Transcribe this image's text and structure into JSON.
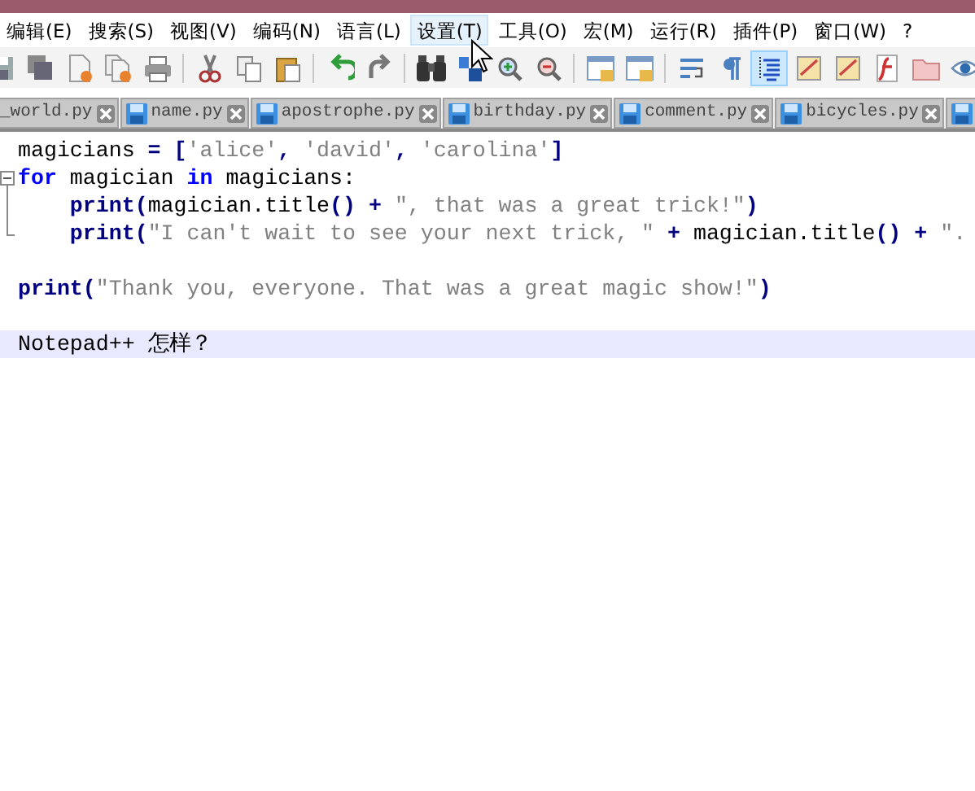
{
  "menu": [
    {
      "label": "编辑(E)",
      "hovered": false
    },
    {
      "label": "搜索(S)",
      "hovered": false
    },
    {
      "label": "视图(V)",
      "hovered": false
    },
    {
      "label": "编码(N)",
      "hovered": false
    },
    {
      "label": "语言(L)",
      "hovered": false
    },
    {
      "label": "设置(T)",
      "hovered": true
    },
    {
      "label": "工具(O)",
      "hovered": false
    },
    {
      "label": "宏(M)",
      "hovered": false
    },
    {
      "label": "运行(R)",
      "hovered": false
    },
    {
      "label": "插件(P)",
      "hovered": false
    },
    {
      "label": "窗口(W)",
      "hovered": false
    },
    {
      "label": "?",
      "hovered": false
    }
  ],
  "toolbar": [
    {
      "kind": "save",
      "pressed": false
    },
    {
      "kind": "save-all",
      "pressed": false
    },
    {
      "kind": "close",
      "pressed": false
    },
    {
      "kind": "close-all",
      "pressed": false
    },
    {
      "kind": "print",
      "pressed": false
    },
    {
      "kind": "sep"
    },
    {
      "kind": "cut",
      "pressed": false
    },
    {
      "kind": "copy",
      "pressed": false
    },
    {
      "kind": "paste",
      "pressed": false
    },
    {
      "kind": "sep"
    },
    {
      "kind": "undo",
      "pressed": false
    },
    {
      "kind": "redo",
      "pressed": false
    },
    {
      "kind": "sep"
    },
    {
      "kind": "find",
      "pressed": false
    },
    {
      "kind": "replace",
      "pressed": false
    },
    {
      "kind": "zoom-in",
      "pressed": false
    },
    {
      "kind": "zoom-out",
      "pressed": false
    },
    {
      "kind": "sep"
    },
    {
      "kind": "sync",
      "pressed": false
    },
    {
      "kind": "sync",
      "pressed": false
    },
    {
      "kind": "sep"
    },
    {
      "kind": "wrap",
      "pressed": false
    },
    {
      "kind": "pilcrow",
      "pressed": false
    },
    {
      "kind": "indent",
      "pressed": true
    },
    {
      "kind": "map",
      "pressed": false
    },
    {
      "kind": "map",
      "pressed": false
    },
    {
      "kind": "function",
      "pressed": false
    },
    {
      "kind": "folder",
      "pressed": false
    },
    {
      "kind": "eye",
      "pressed": false
    }
  ],
  "tabs": [
    {
      "label": "_world.py",
      "selected": false,
      "icon": false
    },
    {
      "label": "name.py",
      "selected": false,
      "icon": true
    },
    {
      "label": "apostrophe.py",
      "selected": false,
      "icon": true
    },
    {
      "label": "birthday.py",
      "selected": false,
      "icon": true
    },
    {
      "label": "comment.py",
      "selected": false,
      "icon": true
    },
    {
      "label": "bicycles.py",
      "selected": false,
      "icon": true
    },
    {
      "selected": false,
      "icon": true
    }
  ],
  "editor": {
    "lines": [
      {
        "current": false,
        "tokens": [
          {
            "kind": "plain",
            "text": "magicians "
          },
          {
            "kind": "op",
            "text": "= ["
          },
          {
            "kind": "string",
            "text": "'alice'"
          },
          {
            "kind": "op",
            "text": ", "
          },
          {
            "kind": "string",
            "text": "'david'"
          },
          {
            "kind": "op",
            "text": ", "
          },
          {
            "kind": "string",
            "text": "'carolina'"
          },
          {
            "kind": "op",
            "text": "]"
          }
        ]
      },
      {
        "current": false,
        "expanded": true,
        "tokens": [
          {
            "kind": "keyword",
            "text": "for"
          },
          {
            "kind": "plain",
            "text": " magician "
          },
          {
            "kind": "keyword",
            "text": "in"
          },
          {
            "kind": "plain",
            "text": " magicians:"
          }
        ],
        "children": [
          {
            "current": false,
            "tokens": [
              {
                "kind": "builtin",
                "text": "    print"
              },
              {
                "kind": "op",
                "text": "("
              },
              {
                "kind": "plain",
                "text": "magician.title"
              },
              {
                "kind": "op",
                "text": "() + "
              },
              {
                "kind": "string",
                "text": "\", that was a great trick!\""
              },
              {
                "kind": "op",
                "text": ")"
              }
            ]
          },
          {
            "current": false,
            "tokens": [
              {
                "kind": "builtin",
                "text": "    print"
              },
              {
                "kind": "op",
                "text": "("
              },
              {
                "kind": "string",
                "text": "\"I can't wait to see your next trick, \""
              },
              {
                "kind": "op",
                "text": " + "
              },
              {
                "kind": "plain",
                "text": "magician.title"
              },
              {
                "kind": "op",
                "text": "() + "
              },
              {
                "kind": "string",
                "text": "\"."
              }
            ]
          }
        ]
      },
      {
        "current": false
      },
      {
        "current": false,
        "tokens": [
          {
            "kind": "builtin",
            "text": "print"
          },
          {
            "kind": "op",
            "text": "("
          },
          {
            "kind": "string",
            "text": "\"Thank you, everyone. That was a great magic show!\""
          },
          {
            "kind": "op",
            "text": ")"
          }
        ]
      },
      {
        "current": false
      },
      {
        "current": true,
        "tokens": [
          {
            "kind": "plain",
            "text": "Notepad++ 怎样？"
          }
        ]
      }
    ]
  }
}
